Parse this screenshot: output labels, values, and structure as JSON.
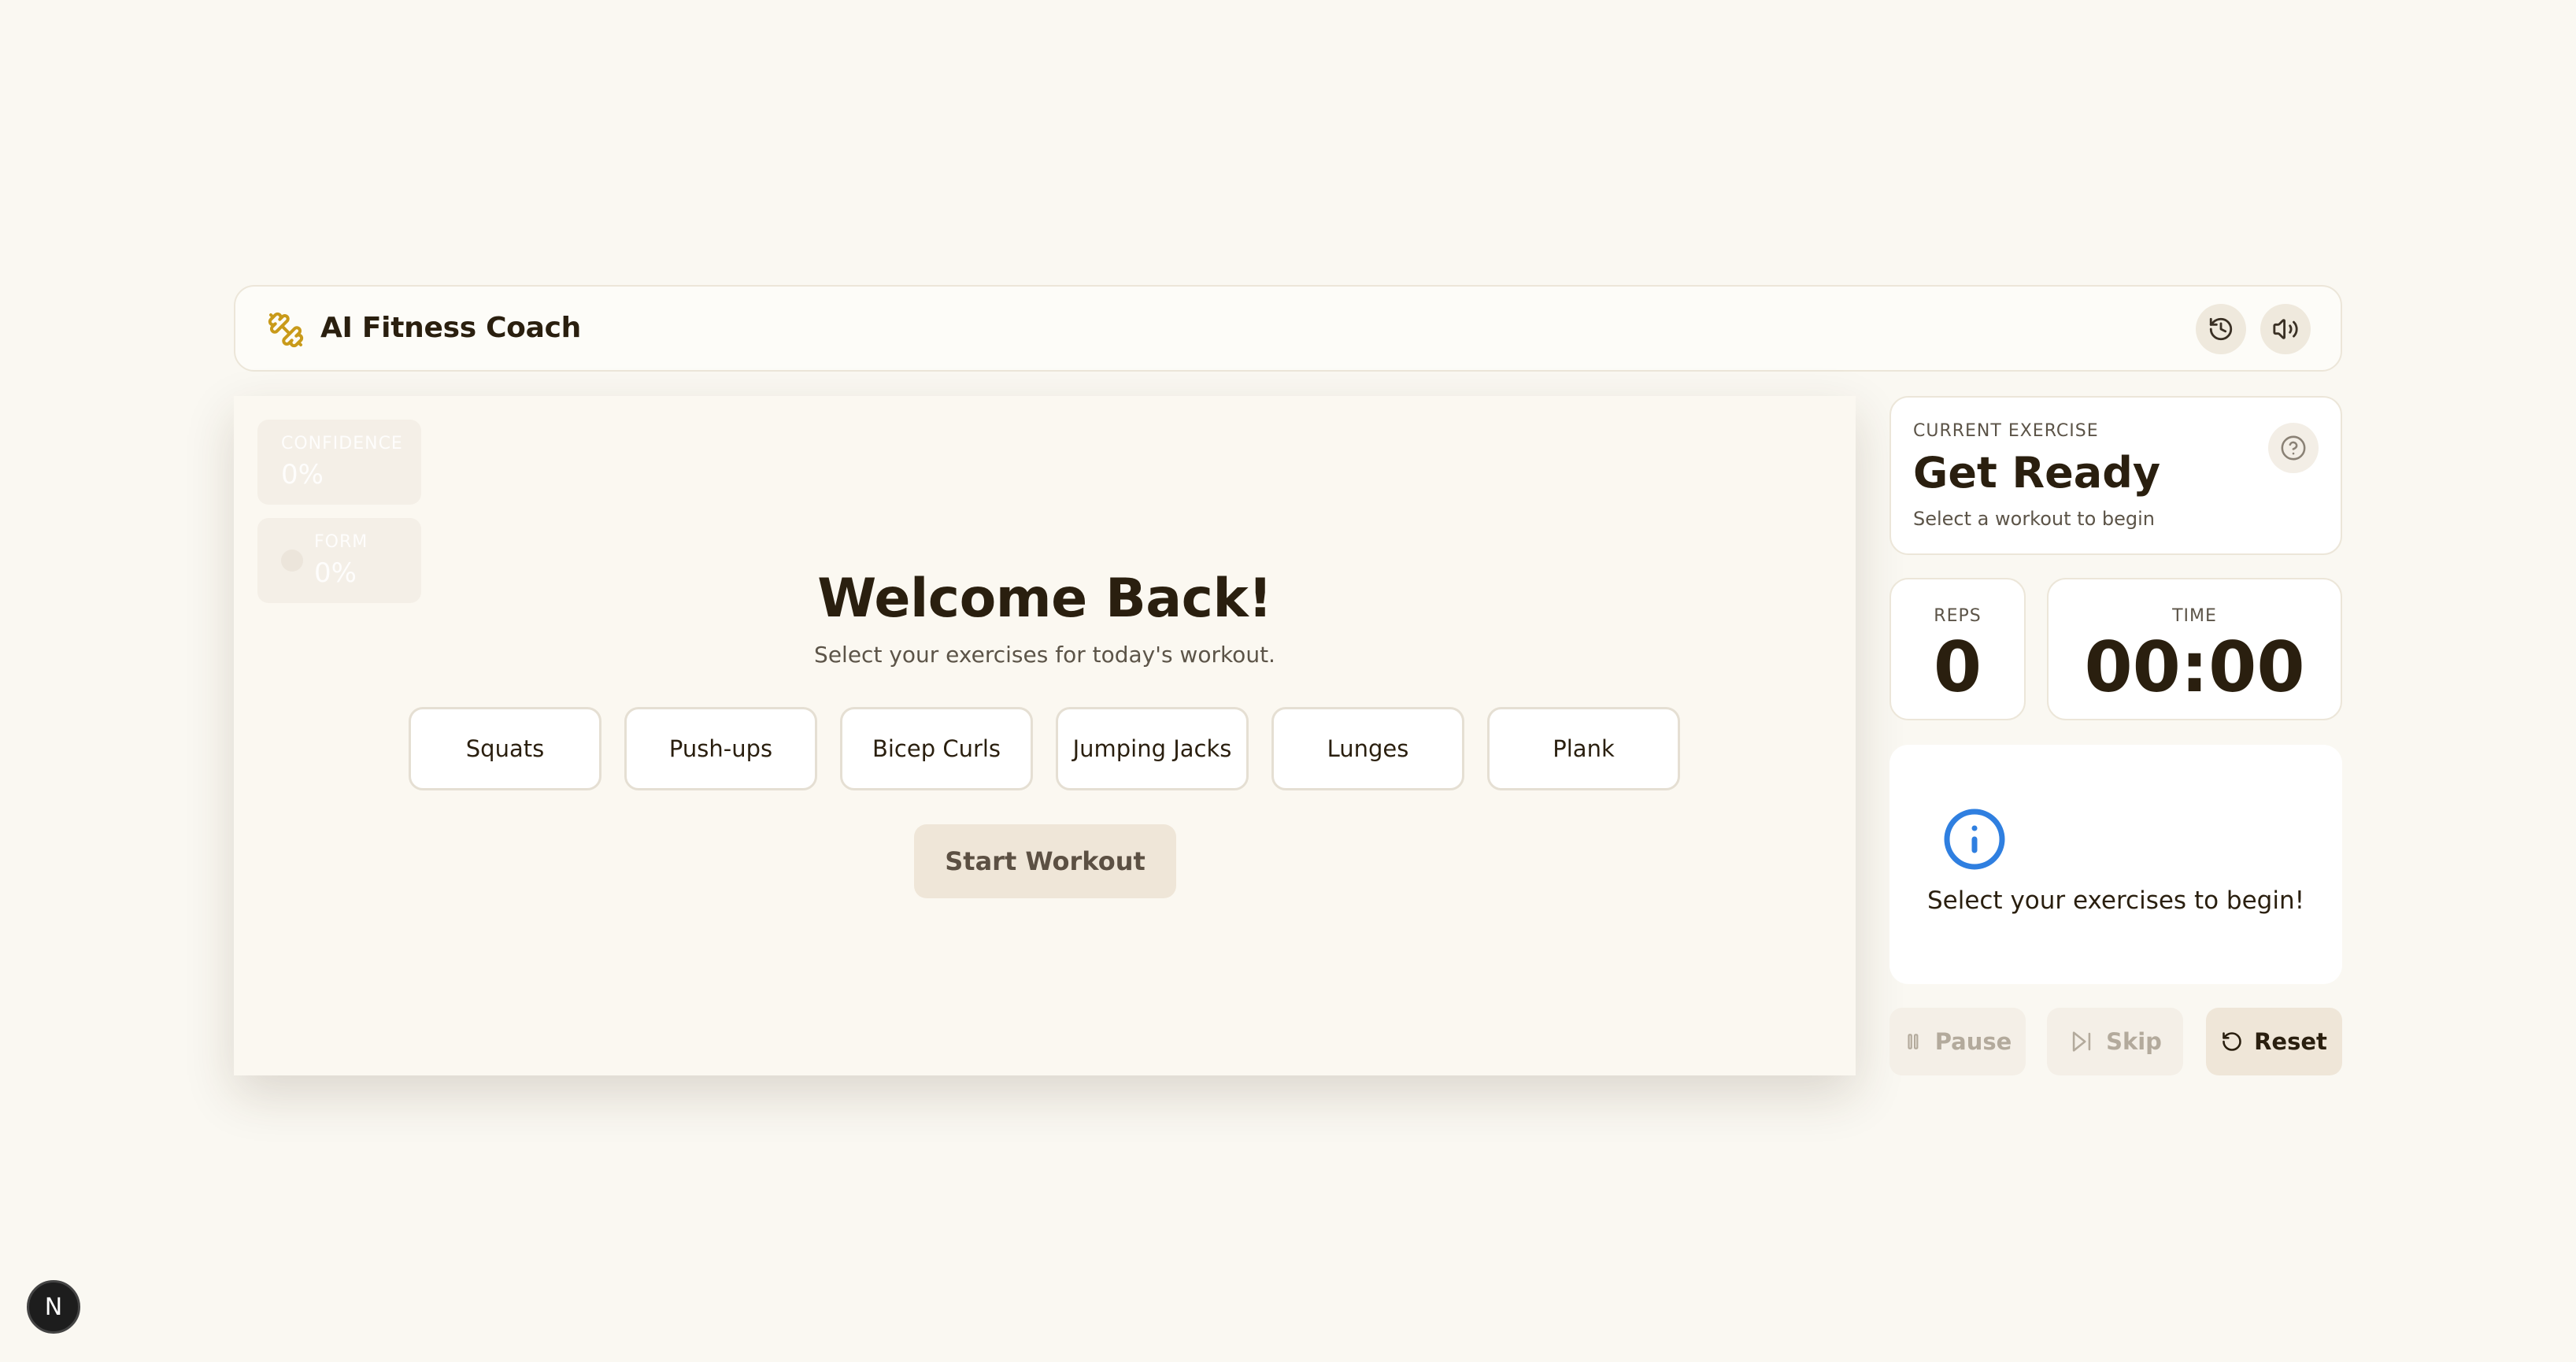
{
  "header": {
    "title": "AI Fitness Coach",
    "logo_icon": "dumbbell-icon",
    "history_icon": "history-icon",
    "sound_icon": "volume-icon"
  },
  "video_overlay": {
    "confidence": {
      "label": "CONFIDENCE",
      "value": "0%"
    },
    "form": {
      "label": "FORM",
      "value": "0%"
    }
  },
  "welcome": {
    "title": "Welcome Back!",
    "subtitle": "Select your exercises for today's workout."
  },
  "exercises": [
    {
      "label": "Squats"
    },
    {
      "label": "Push-ups"
    },
    {
      "label": "Bicep Curls"
    },
    {
      "label": "Jumping Jacks"
    },
    {
      "label": "Lunges"
    },
    {
      "label": "Plank"
    }
  ],
  "start_button": {
    "label": "Start Workout"
  },
  "current_exercise": {
    "label": "CURRENT EXERCISE",
    "name": "Get Ready",
    "subtitle": "Select a workout to begin"
  },
  "reps": {
    "label": "REPS",
    "value": "0"
  },
  "time": {
    "label": "TIME",
    "value": "00:00"
  },
  "info": {
    "message": "Select your exercises to begin!"
  },
  "controls": {
    "pause": "Pause",
    "skip": "Skip",
    "reset": "Reset"
  },
  "dev_badge": {
    "label": "N"
  },
  "colors": {
    "background": "#faf8f2",
    "accent": "#c99a1a",
    "info_blue": "#2f7fe0",
    "text_dark": "#2a1f0f"
  }
}
